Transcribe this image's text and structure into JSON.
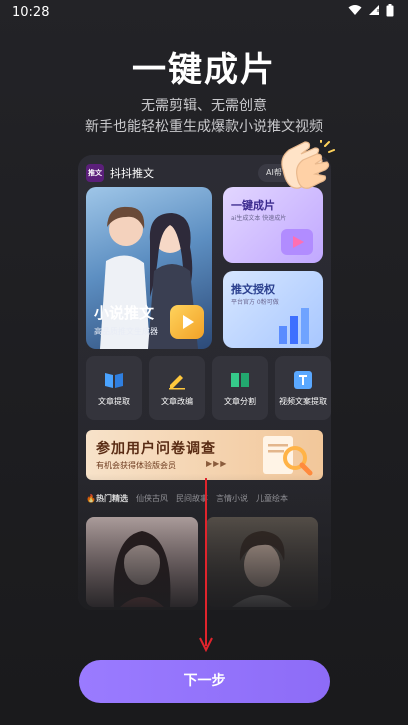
{
  "status_bar": {
    "time": "10:28"
  },
  "hero": {
    "title": "一键成片",
    "subtitle_line1": "无需剪辑、无需创意",
    "subtitle_line2": "新手也能轻松重生成爆款小说推文视频"
  },
  "preview": {
    "app_logo_text": "推文",
    "app_name": "抖抖推文",
    "ai_chip": "AI帮",
    "novel_card": {
      "title": "小说推文",
      "subtitle": "高品质推文生成器"
    },
    "cards": [
      {
        "title": "一键成片",
        "subtitle": "ai生成文本 快速成片"
      },
      {
        "title": "推文授权",
        "subtitle": "平台官方 0粉可做"
      }
    ],
    "tools": [
      {
        "label": "文章提取",
        "icon": "book-icon",
        "color": "#4aa3ff"
      },
      {
        "label": "文章改编",
        "icon": "pencil-icon",
        "color": "#ffc83d"
      },
      {
        "label": "文章分割",
        "icon": "split-book-icon",
        "color": "#35c98a"
      },
      {
        "label": "视频文案提取",
        "icon": "text-extract-icon",
        "color": "#5aa8ff"
      }
    ],
    "survey": {
      "title": "参加用户问卷调查",
      "subtitle": "有机会获得体验版会员",
      "arrows": "▶▶▶"
    },
    "categories": [
      "热门精选",
      "仙侠古风",
      "民间故事",
      "言情小说",
      "儿童绘本"
    ]
  },
  "next_button": {
    "label": "下一步"
  },
  "colors": {
    "accent": "#9a7bff",
    "background": "#1f1f22"
  }
}
